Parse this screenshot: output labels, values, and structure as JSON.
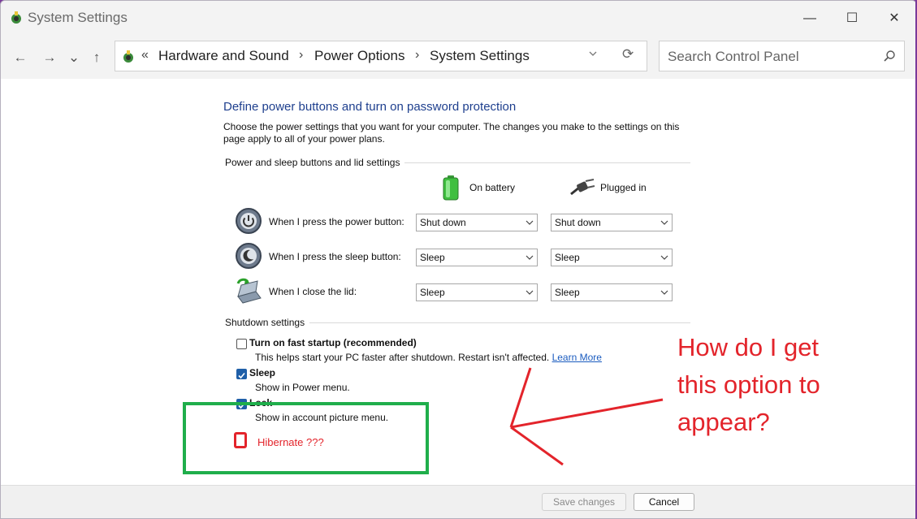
{
  "window": {
    "title": "System Settings",
    "controls": {
      "minimize": "—",
      "maximize": "☐",
      "close": "✕"
    }
  },
  "nav": {
    "back": "←",
    "forward": "→",
    "recent": "⌄",
    "up": "↑",
    "breadcrumb_prefix": "«",
    "breadcrumbs": [
      "Hardware and Sound",
      "Power Options",
      "System Settings"
    ],
    "separator": "›",
    "refresh": "⟳",
    "search_placeholder": "Search Control Panel"
  },
  "page": {
    "heading": "Define power buttons and turn on password protection",
    "description": "Choose the power settings that you want for your computer. The changes you make to the settings on this page apply to all of your power plans.",
    "section1_label": "Power and sleep buttons and lid settings",
    "columns": {
      "battery": "On battery",
      "plugged": "Plugged in"
    },
    "rows": [
      {
        "label": "When I press the power button:",
        "battery": "Shut down",
        "plugged": "Shut down"
      },
      {
        "label": "When I press the sleep button:",
        "battery": "Sleep",
        "plugged": "Sleep"
      },
      {
        "label": "When I close the lid:",
        "battery": "Sleep",
        "plugged": "Sleep"
      }
    ],
    "section2_label": "Shutdown settings",
    "options": [
      {
        "label": "Turn on fast startup (recommended)",
        "checked": false,
        "desc": "This helps start your PC faster after shutdown. Restart isn't affected.",
        "link": "Learn More"
      },
      {
        "label": "Sleep",
        "checked": true,
        "desc": "Show in Power menu."
      },
      {
        "label": "Lock",
        "checked": true,
        "desc": "Show in account picture menu."
      }
    ]
  },
  "footer": {
    "save": "Save changes",
    "cancel": "Cancel"
  },
  "annotation": {
    "hibernate": "Hibernate  ???",
    "question": "How do I get this option to appear?",
    "colors": {
      "red": "#e3242b",
      "green": "#1fae4b"
    }
  }
}
